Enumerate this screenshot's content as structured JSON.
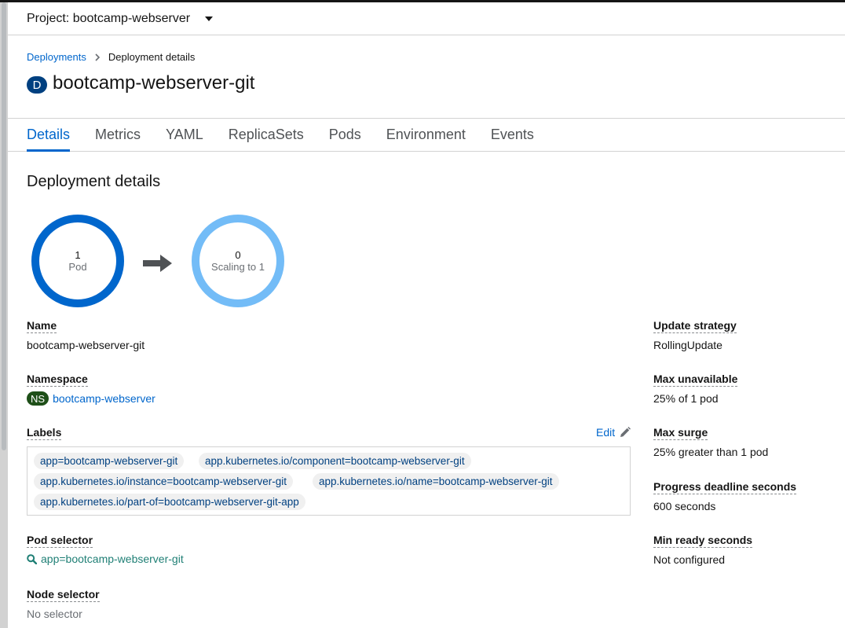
{
  "project": {
    "label": "Project: bootcamp-webserver"
  },
  "breadcrumb": {
    "parent": "Deployments",
    "current": "Deployment details"
  },
  "header": {
    "badge": "D",
    "title": "bootcamp-webserver-git"
  },
  "tabs": [
    {
      "label": "Details",
      "active": true
    },
    {
      "label": "Metrics"
    },
    {
      "label": "YAML"
    },
    {
      "label": "ReplicaSets"
    },
    {
      "label": "Pods"
    },
    {
      "label": "Environment"
    },
    {
      "label": "Events"
    }
  ],
  "section": {
    "title": "Deployment details"
  },
  "pod_status": {
    "current": {
      "count": "1",
      "label": "Pod",
      "color": "#0066cc"
    },
    "target": {
      "count": "0",
      "label": "Scaling to 1",
      "color": "#73bcf7"
    },
    "arrow_icon": "arrow-right-icon"
  },
  "left_fields": {
    "name": {
      "label": "Name",
      "value": "bootcamp-webserver-git"
    },
    "namespace": {
      "label": "Namespace",
      "badge": "NS",
      "value": "bootcamp-webserver"
    },
    "labels": {
      "label": "Labels",
      "edit": "Edit",
      "items": [
        "app=bootcamp-webserver-git",
        "app.kubernetes.io/component=bootcamp-webserver-git",
        "app.kubernetes.io/instance=bootcamp-webserver-git",
        "app.kubernetes.io/name=bootcamp-webserver-git",
        "app.kubernetes.io/part-of=bootcamp-webserver-git-app"
      ]
    },
    "pod_selector": {
      "label": "Pod selector",
      "value": "app=bootcamp-webserver-git"
    },
    "node_selector": {
      "label": "Node selector",
      "value": "No selector"
    }
  },
  "right_fields": {
    "update_strategy": {
      "label": "Update strategy",
      "value": "RollingUpdate"
    },
    "max_unavailable": {
      "label": "Max unavailable",
      "value": "25% of 1 pod"
    },
    "max_surge": {
      "label": "Max surge",
      "value": "25% greater than 1 pod"
    },
    "progress_deadline": {
      "label": "Progress deadline seconds",
      "value": "600 seconds"
    },
    "min_ready": {
      "label": "Min ready seconds",
      "value": "Not configured"
    }
  },
  "colors": {
    "link": "#0066cc",
    "namespace_badge": "#1e4f18",
    "title_badge": "#004080",
    "selector_link": "#1f7f75"
  }
}
